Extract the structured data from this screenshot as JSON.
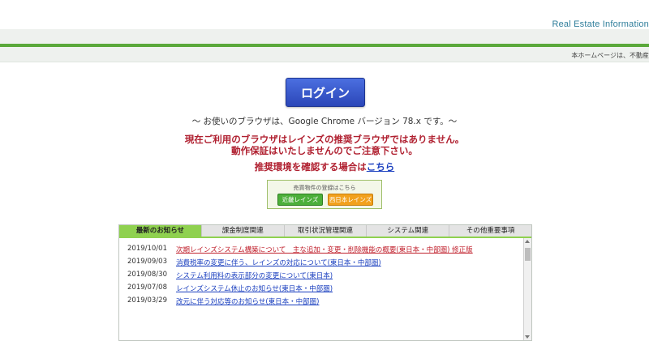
{
  "header": {
    "title": "Real Estate Information",
    "sub_note": "本ホームページは、不動産"
  },
  "login": {
    "label": "ログイン"
  },
  "browser_info": "～ お使いのブラウザは、Google Chrome バージョン 78.x です。～",
  "warning": {
    "line1": "現在ご利用のブラウザはレインズの推奨ブラウザではありません。",
    "line2": "動作保証はいたしませんのでご注意下さい。"
  },
  "recommend": {
    "text": "推奨環境を確認する場合は",
    "link": "こちら"
  },
  "registration": {
    "caption": "売買物件の登録はこちら",
    "kinki": "近畿レインズ",
    "nishinihon": "西日本レインズ"
  },
  "news": {
    "tabs": [
      {
        "label": "最新のお知らせ",
        "active": true
      },
      {
        "label": "課金制度関連",
        "active": false
      },
      {
        "label": "取引状況管理関連",
        "active": false
      },
      {
        "label": "システム関連",
        "active": false
      },
      {
        "label": "その他重要事項",
        "active": false
      }
    ],
    "items": [
      {
        "date": "2019/10/01",
        "title": "次期レインズシステム構築について　主な追加・変更・削除機能の概要(東日本・中部圏) 修正版",
        "color": "#c0202c"
      },
      {
        "date": "2019/09/03",
        "title": "消費税率の変更に伴う、レインズの対応について(東日本・中部圏)",
        "color": "#1a3fbf"
      },
      {
        "date": "2019/08/30",
        "title": "システム利用料の表示部分の変更について(東日本)",
        "color": "#1a3fbf"
      },
      {
        "date": "2019/07/08",
        "title": "レインズシステム休止のお知らせ(東日本・中部圏)",
        "color": "#1a3fbf"
      },
      {
        "date": "2019/03/29",
        "title": "改元に伴う対応等のお知らせ(東日本・中部圏)",
        "color": "#1a3fbf"
      }
    ]
  },
  "colors": {
    "accent_green": "#5aa83a",
    "login_blue": "#2b46b8",
    "warning_red": "#b02030",
    "link_blue": "#1a3fbf"
  }
}
